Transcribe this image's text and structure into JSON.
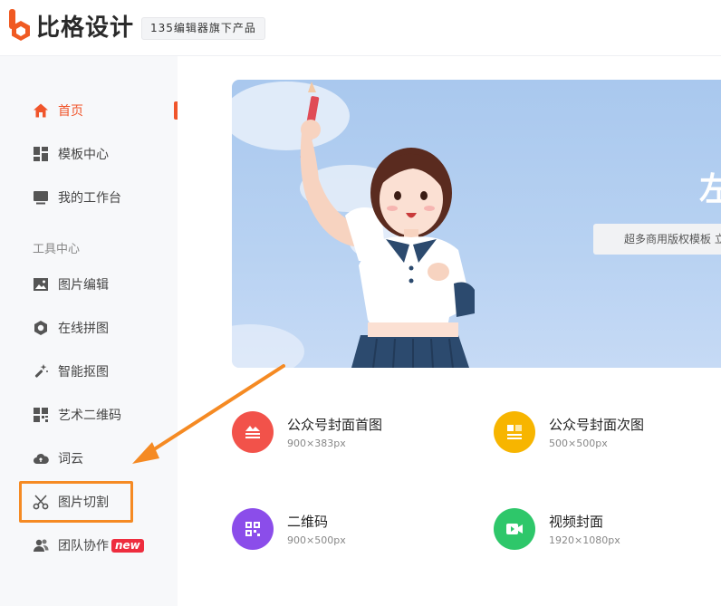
{
  "header": {
    "logo_text": "比格设计",
    "tagline": "135编辑器旗下产品"
  },
  "sidebar": {
    "items": [
      {
        "label": "首页",
        "icon": "home-icon",
        "active": true
      },
      {
        "label": "模板中心",
        "icon": "grid-icon"
      },
      {
        "label": "我的工作台",
        "icon": "monitor-icon"
      }
    ],
    "section_label": "工具中心",
    "tools": [
      {
        "label": "图片编辑",
        "icon": "image-icon"
      },
      {
        "label": "在线拼图",
        "icon": "hexagon-icon"
      },
      {
        "label": "智能抠图",
        "icon": "magic-wand-icon"
      },
      {
        "label": "艺术二维码",
        "icon": "qrcode-icon"
      },
      {
        "label": "词云",
        "icon": "cloud-icon"
      },
      {
        "label": "图片切割",
        "icon": "scissors-icon"
      },
      {
        "label": "团队协作",
        "icon": "team-icon",
        "badge": "new"
      }
    ]
  },
  "banner": {
    "title": "左",
    "subtitle": "超多商用版权模板 立"
  },
  "cards": [
    {
      "title": "公众号封面首图",
      "size": "900×383px",
      "icon": "cover-first-icon",
      "color": "#f2524a"
    },
    {
      "title": "公众号封面次图",
      "size": "500×500px",
      "icon": "cover-second-icon",
      "color": "#f7b500"
    },
    {
      "title": "二维码",
      "size": "900×500px",
      "icon": "qrcode-icon",
      "color": "#8b4dea"
    },
    {
      "title": "视频封面",
      "size": "1920×1080px",
      "icon": "video-icon",
      "color": "#2ec76a"
    }
  ],
  "colors": {
    "accent": "#f0552b",
    "highlight": "#f58a23",
    "badge": "#ee2d3e"
  }
}
